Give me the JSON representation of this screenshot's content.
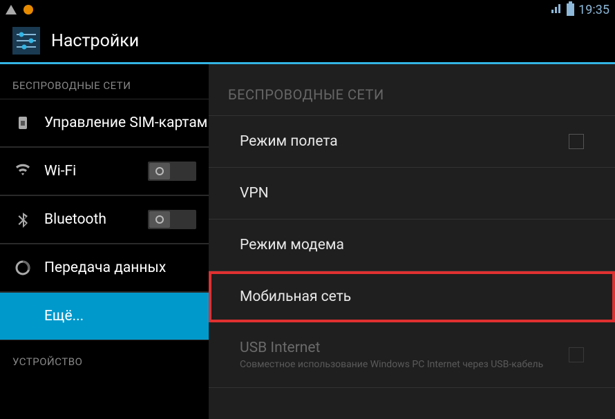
{
  "status": {
    "time": "19:35"
  },
  "header": {
    "title": "Настройки"
  },
  "sidebar": {
    "section1": "БЕСПРОВОДНЫЕ СЕТИ",
    "sim": "Управление SIM-картами",
    "wifi": "Wi-Fi",
    "bluetooth": "Bluetooth",
    "data": "Передача данных",
    "more": "Ещё...",
    "section2": "УСТРОЙСТВО"
  },
  "detail": {
    "section": "Беспроводные сети",
    "airplane": "Режим полета",
    "vpn": "VPN",
    "tethering": "Режим модема",
    "mobile": "Мобильная сеть",
    "usb_title": "USB Internet",
    "usb_sub": "Совместное использование Windows PC Internet через USB-кабель"
  }
}
